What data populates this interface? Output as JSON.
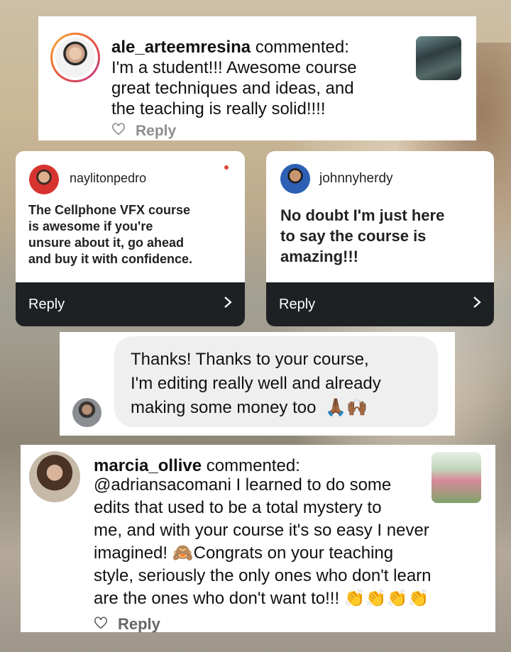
{
  "comments": [
    {
      "username": "ale_arteemresina",
      "verb": "commented:",
      "lines": [
        "I'm a student!!! Awesome course",
        "great techniques and ideas, and",
        "the teaching is really solid!!!!"
      ],
      "reply_label": "Reply"
    },
    {
      "username": "naylitonpedro",
      "lines": [
        "The Cellphone VFX course",
        "is awesome if you're",
        "unsure about it, go ahead",
        "and buy it with confidence."
      ],
      "reply_label": "Reply"
    },
    {
      "username": "johnnyherdy",
      "lines": [
        "No doubt I'm just here",
        "to say the course is",
        "amazing!!!"
      ],
      "reply_label": "Reply"
    },
    {
      "lines": [
        "Thanks! Thanks to your course,",
        "I'm editing really well and already",
        "making some money too"
      ],
      "emoji": "🙏🏾🙌🏾"
    },
    {
      "username": "marcia_ollive",
      "verb": "commented:",
      "lines": [
        "@adriansacomani I learned to do some",
        "edits that used to be a total mystery to",
        "me, and with your course it's so easy I never",
        "imagined! 🙈Congrats on your teaching",
        "style, seriously the only ones who don't learn",
        "are the ones who don't want to!!! 👏👏👏👏"
      ],
      "reply_label": "Reply"
    }
  ],
  "colors": {
    "story_ring_start": "#f9b233",
    "story_ring_end": "#c13584",
    "unread_dot": "#e0463a",
    "dark_bar": "#1e2124",
    "bubble": "#efefef"
  },
  "icons": {
    "heart": "heart-icon",
    "chevron": "chevron-right-icon"
  }
}
